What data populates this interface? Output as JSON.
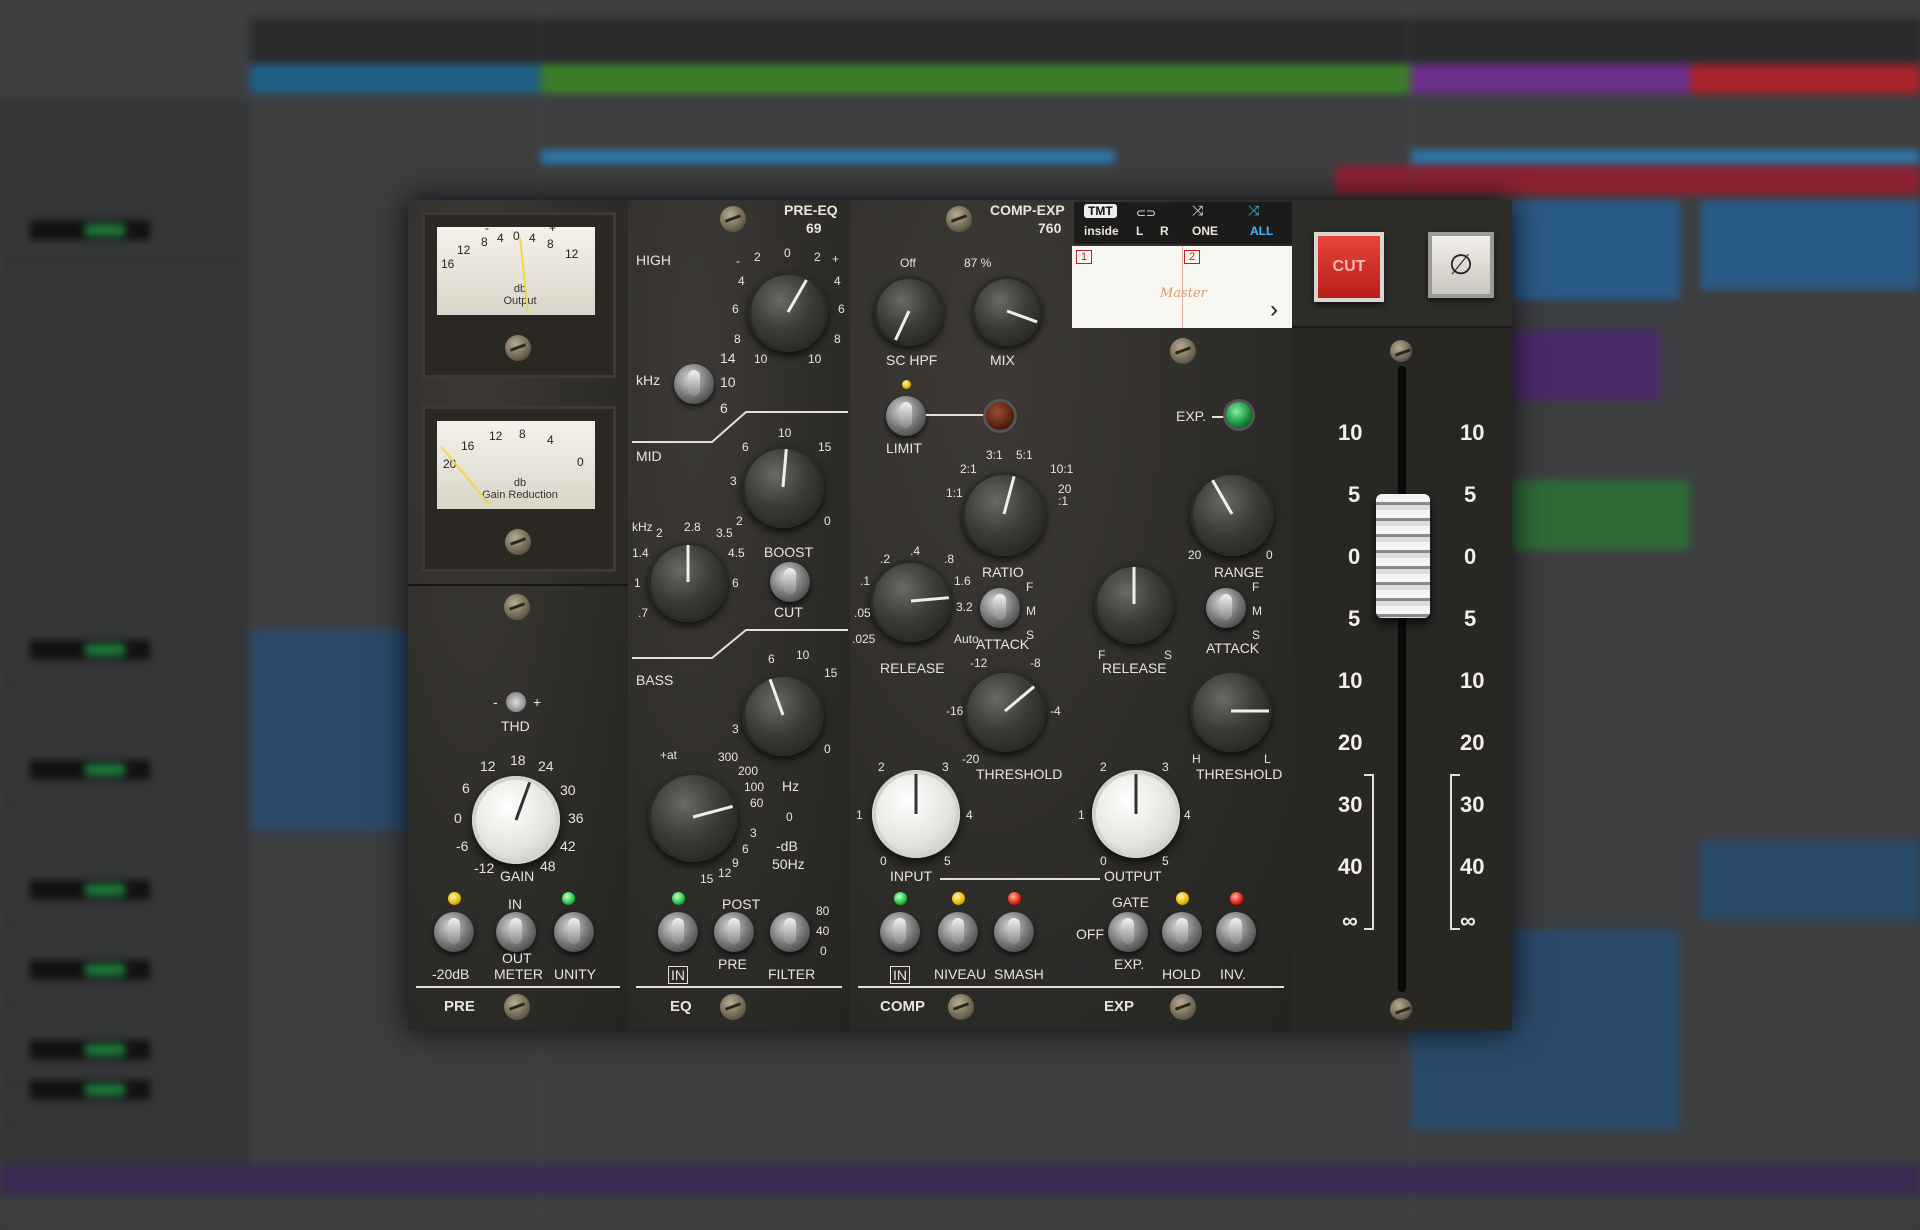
{
  "pre": {
    "meter_output": {
      "scale": [
        "16",
        "12",
        "8",
        "4",
        "0",
        "4",
        "8",
        "12"
      ],
      "minus": "-",
      "plus": "+",
      "label1": "db",
      "label2": "Output"
    },
    "meter_gr": {
      "scale": [
        "20",
        "16",
        "12",
        "8",
        "4",
        "0"
      ],
      "label1": "db",
      "label2": "Gain Reduction"
    },
    "thd": "THD",
    "thd_minus": "-",
    "thd_plus": "+",
    "gain_label": "GAIN",
    "gain_scale": [
      "12",
      "18",
      "24",
      "6",
      "30",
      "0",
      "36",
      "-6",
      "42",
      "-12",
      "48"
    ],
    "switch_20db": "-20dB",
    "switch_meter_top": "IN",
    "switch_meter_mid": "OUT",
    "switch_meter": "METER",
    "switch_unity": "UNITY",
    "section_title": "PRE"
  },
  "eq": {
    "title": "PRE-EQ",
    "subtitle": "69",
    "high": "HIGH",
    "high_scale": [
      "-",
      "2",
      "0",
      "2",
      "+",
      "4",
      "4",
      "6",
      "6",
      "8",
      "8",
      "10",
      "10"
    ],
    "khz": "kHz",
    "high_freq": [
      "14",
      "10",
      "6"
    ],
    "mid": "MID",
    "mid_scale": [
      "6",
      "10",
      "15",
      "3",
      "2",
      "0"
    ],
    "mid_khz": "kHz",
    "mid_freq": [
      "2",
      "2.8",
      "3.5",
      "1.4",
      "4.5",
      "1",
      "6",
      ".7"
    ],
    "boost": "BOOST",
    "cut": "CUT",
    "bass": "BASS",
    "bass_scale": [
      "6",
      "10",
      "15",
      "3",
      "0"
    ],
    "at": "+at",
    "hz": "Hz",
    "bass_freq": [
      "300",
      "200",
      "100",
      "60",
      "0",
      "3",
      "6",
      "9",
      "12",
      "15"
    ],
    "db": "-dB",
    "hz50": "50Hz",
    "filter_scale": [
      "80",
      "40",
      "0"
    ],
    "in": "IN",
    "post": "POST",
    "pre": "PRE",
    "filter": "FILTER",
    "section_title": "EQ"
  },
  "comp": {
    "title": "COMP-EXP",
    "subtitle": "760",
    "schpf": "SC HPF",
    "schpf_off": "Off",
    "mix": "MIX",
    "mix_val": "87 %",
    "limit": "LIMIT",
    "ratio": "RATIO",
    "ratio_scale": [
      "2:1",
      "3:1",
      "5:1",
      "10:1",
      "1:1",
      "20",
      ":1"
    ],
    "release": "RELEASE",
    "release_scale": [
      ".2",
      ".4",
      ".8",
      ".1",
      "1.6",
      ".05",
      "3.2",
      ".025",
      "Auto"
    ],
    "attack": "ATTACK",
    "attack_fms": [
      "F",
      "M",
      "S"
    ],
    "threshold": "THRESHOLD",
    "threshold_scale": [
      "-12",
      "-8",
      "-16",
      "-4",
      "-20"
    ],
    "input": "INPUT",
    "input_scale": [
      "2",
      "3",
      "1",
      "4",
      "0",
      "5"
    ],
    "in": "IN",
    "niveau": "NIVEAU",
    "smash": "SMASH",
    "section_title": "COMP"
  },
  "exp": {
    "exp_label": "EXP.",
    "range": "RANGE",
    "range_scale": [
      "20",
      "0"
    ],
    "release": "RELEASE",
    "release_fs": [
      "F",
      "S"
    ],
    "attack": "ATTACK",
    "attack_fms": [
      "F",
      "M",
      "S"
    ],
    "threshold": "THRESHOLD",
    "threshold_hl": [
      "H",
      "L"
    ],
    "output": "OUTPUT",
    "output_scale": [
      "2",
      "3",
      "1",
      "4",
      "0",
      "5"
    ],
    "gate": "GATE",
    "off": "OFF",
    "exp": "EXP.",
    "hold": "HOLD",
    "inv": "INV.",
    "section_title": "EXP"
  },
  "header": {
    "tmt": "TMT",
    "inside": "inside",
    "left": "L",
    "right": "R",
    "one": "ONE",
    "all": "ALL",
    "slot1": "1",
    "slot2": "2",
    "display_text": "Master",
    "arrow": "›"
  },
  "fader": {
    "cut": "CUT",
    "phase": "∅",
    "scale_left": [
      "10",
      "5",
      "0",
      "5",
      "10",
      "20",
      "30",
      "40",
      "∞"
    ],
    "scale_right": [
      "10",
      "5",
      "0",
      "5",
      "10",
      "20",
      "30",
      "40",
      "∞"
    ]
  },
  "colors": {
    "cut_red": "#d8302a",
    "led_green": "#20c040",
    "led_yellow": "#e0b800",
    "led_red": "#e02010",
    "all_blue": "#3fb8ff"
  }
}
